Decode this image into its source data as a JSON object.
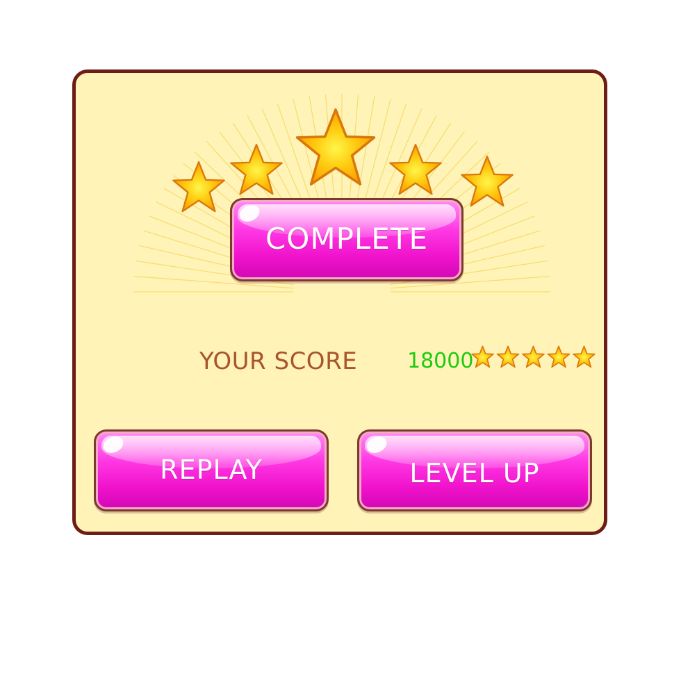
{
  "dialog": {
    "title_button": "COMPLETE",
    "score_label": "YOUR SCORE",
    "score_value": "18000",
    "stars_earned": 5,
    "stars_max": 5
  },
  "buttons": {
    "replay": "REPLAY",
    "level_up": "LEVEL UP"
  },
  "colors": {
    "panel_fill": "#fff3b8",
    "panel_border": "#6e1d16",
    "button_pink": "#ff38e4",
    "score_label": "#a8552c",
    "score_value": "#1ecb12",
    "star_gold": "#ffb400",
    "ray": "#f6dd6a"
  },
  "icons": {
    "header_star": "star-icon",
    "score_star": "star-icon"
  }
}
